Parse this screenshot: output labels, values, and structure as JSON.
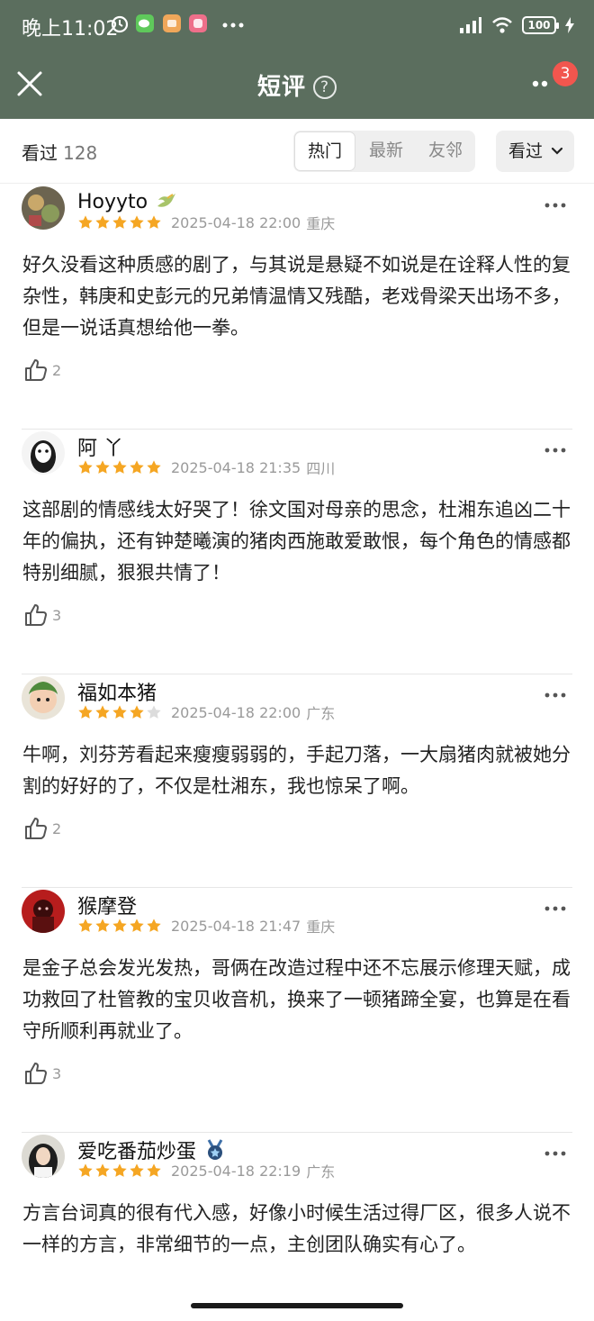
{
  "status_bar": {
    "time": "晚上11:02",
    "battery": "100"
  },
  "nav": {
    "title": "短评",
    "help_icon": "?",
    "badge_count": "3"
  },
  "toolbar": {
    "count_label": "看过",
    "count_value": "128",
    "tabs": [
      "热门",
      "最新",
      "友邻"
    ],
    "active_tab": "热门",
    "filter_label": "看过"
  },
  "reviews": [
    {
      "user": "Hoyyto",
      "rating": 5,
      "date": "2025-04-18 22:00",
      "location": "重庆",
      "content": "好久没看这种质感的剧了，与其说是悬疑不如说是在诠释人性的复杂性，韩庚和史彭元的兄弟情温情又残酷，老戏骨梁天出场不多，但是一说话真想给他一拳。",
      "likes": "2"
    },
    {
      "user": "阿  丫",
      "rating": 5,
      "date": "2025-04-18 21:35",
      "location": "四川",
      "content": "这部剧的情感线太好哭了！徐文国对母亲的思念，杜湘东追凶二十年的偏执，还有钟楚曦演的猪肉西施敢爱敢恨，每个角色的情感都特别细腻，狠狠共情了！",
      "likes": "3"
    },
    {
      "user": "福如本猪",
      "rating": 4,
      "date": "2025-04-18 22:00",
      "location": "广东",
      "content": "牛啊，刘芬芳看起来瘦瘦弱弱的，手起刀落，一大扇猪肉就被她分割的好好的了，不仅是杜湘东，我也惊呆了啊。",
      "likes": "2"
    },
    {
      "user": "猴摩登",
      "rating": 5,
      "date": "2025-04-18 21:47",
      "location": "重庆",
      "content": " 是金子总会发光发热，哥俩在改造过程中还不忘展示修理天赋，成功救回了杜管教的宝贝收音机，换来了一顿猪蹄全宴，也算是在看守所顺利再就业了。",
      "likes": "3"
    },
    {
      "user": "爱吃番茄炒蛋",
      "rating": 5,
      "date": "2025-04-18 22:19",
      "location": "广东",
      "content": "方言台词真的很有代入感，好像小时候生活过得厂区，很多人说不一样的方言，非常细节的一点，主创团队确实有心了。",
      "likes": ""
    }
  ],
  "colors": {
    "header_bg": "#5b6e5e",
    "star": "#f5a623",
    "star_empty": "#dcdcdc",
    "badge": "#f2564e"
  }
}
